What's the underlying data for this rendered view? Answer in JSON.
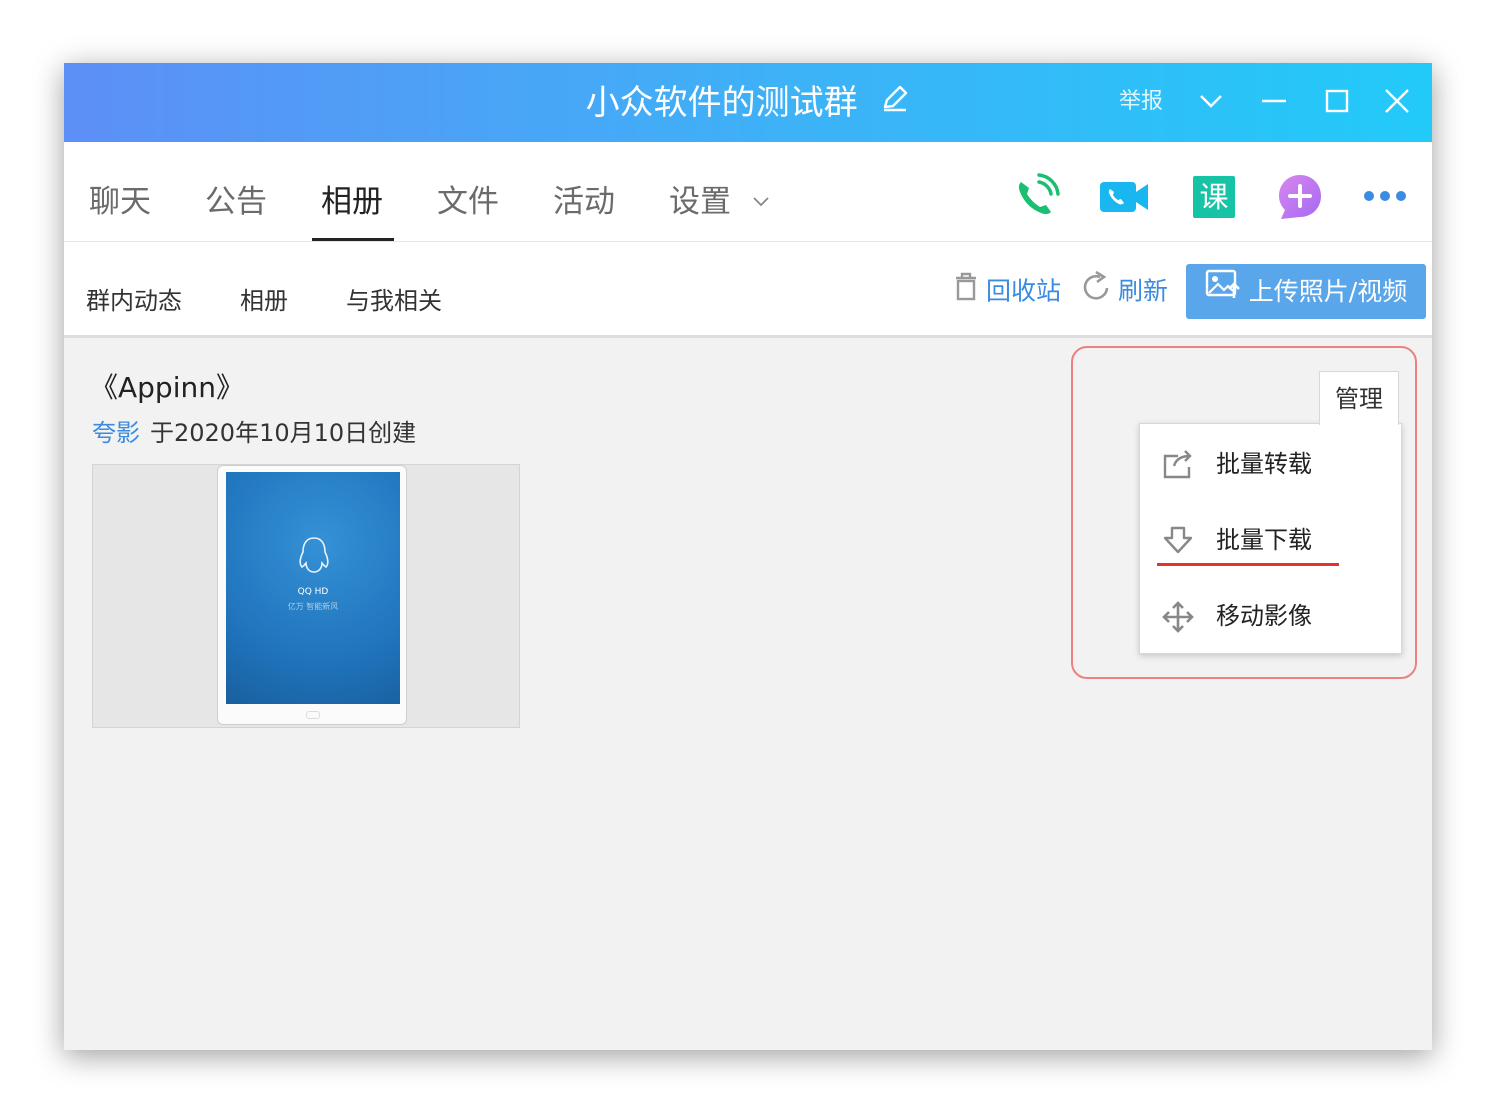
{
  "window": {
    "title": "小众软件的测试群",
    "report_label": "举报"
  },
  "tabs": [
    {
      "label": "聊天"
    },
    {
      "label": "公告"
    },
    {
      "label": "相册"
    },
    {
      "label": "文件"
    },
    {
      "label": "活动"
    },
    {
      "label": "设置"
    }
  ],
  "active_tab": "相册",
  "toolbar_icons": [
    "phone-call-icon",
    "video-call-icon",
    "course-icon",
    "add-app-icon",
    "more-icon"
  ],
  "course_icon_glyph": "课",
  "subtabs": [
    {
      "label": "群内动态"
    },
    {
      "label": "相册"
    },
    {
      "label": "与我相关"
    }
  ],
  "actions": {
    "recycle_label": "回收站",
    "refresh_label": "刷新",
    "upload_label": "上传照片/视频"
  },
  "album": {
    "title": "《Appinn》",
    "author": "夸影",
    "created": "于2020年10月10日创建",
    "photo": {
      "app_name": "QQ HD",
      "tagline": "亿万 智能新风"
    }
  },
  "manage": {
    "button_label": "管理",
    "menu": [
      {
        "label": "批量转载",
        "icon": "share-out-icon"
      },
      {
        "label": "批量下载",
        "icon": "download-icon"
      },
      {
        "label": "移动影像",
        "icon": "move-icon"
      }
    ]
  },
  "colors": {
    "titlebar_start": "#5d8ff6",
    "titlebar_end": "#22caf9",
    "link_blue": "#3b8be0",
    "upload_button": "#5aa6ea",
    "highlight_border": "#ef8080",
    "annotation_red": "#e0342c"
  }
}
